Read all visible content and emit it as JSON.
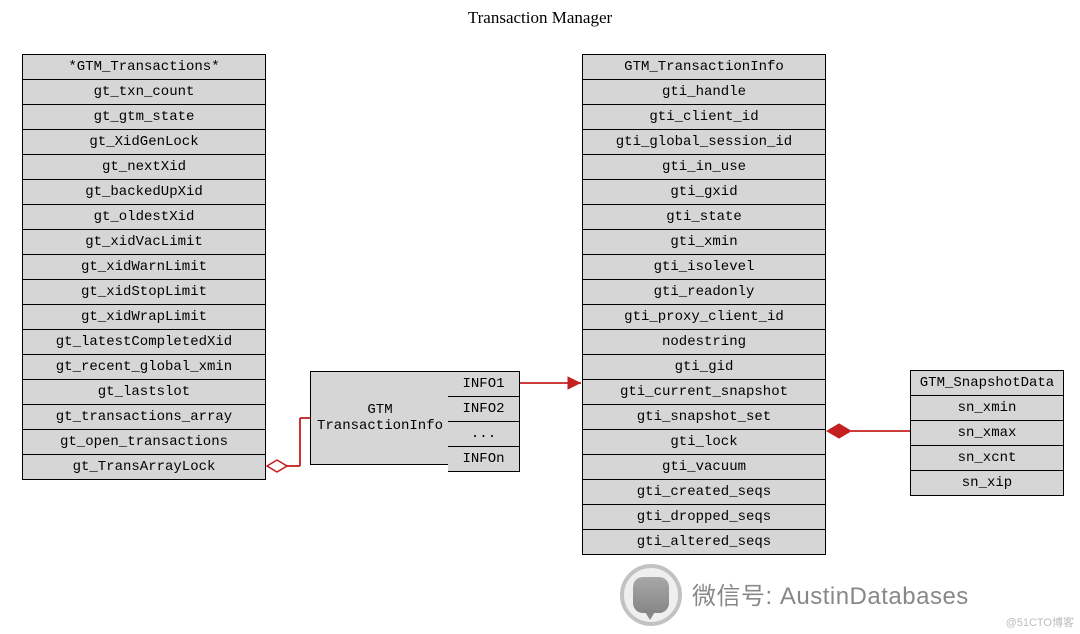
{
  "title": "Transaction Manager",
  "tables": {
    "gtm_transactions": {
      "header": "*GTM_Transactions*",
      "rows": [
        "gt_txn_count",
        "gt_gtm_state",
        "gt_XidGenLock",
        "gt_nextXid",
        "gt_backedUpXid",
        "gt_oldestXid",
        "gt_xidVacLimit",
        "gt_xidWarnLimit",
        "gt_xidStopLimit",
        "gt_xidWrapLimit",
        "gt_latestCompletedXid",
        "gt_recent_global_xmin",
        "gt_lastslot",
        "gt_transactions_array",
        "gt_open_transactions",
        "gt_TransArrayLock"
      ]
    },
    "mid": {
      "label_line1": "GTM",
      "label_line2": "TransactionInfo",
      "slots": [
        "INFO1",
        "INFO2",
        "...",
        "INFOn"
      ]
    },
    "txn_info": {
      "header": "GTM_TransactionInfo",
      "rows": [
        "gti_handle",
        "gti_client_id",
        "gti_global_session_id",
        "gti_in_use",
        "gti_gxid",
        "gti_state",
        "gti_xmin",
        "gti_isolevel",
        "gti_readonly",
        "gti_proxy_client_id",
        "nodestring",
        "gti_gid",
        "gti_current_snapshot",
        "gti_snapshot_set",
        "gti_lock",
        "gti_vacuum",
        "gti_created_seqs",
        "gti_dropped_seqs",
        "gti_altered_seqs"
      ]
    },
    "snapshot": {
      "header": "GTM_SnapshotData",
      "rows": [
        "sn_xmin",
        "sn_xmax",
        "sn_xcnt",
        "sn_xip"
      ]
    }
  },
  "watermark": {
    "prefix": "微信号:",
    "name": "AustinDatabases",
    "credit": "@51CTO博客"
  },
  "chart_data": {
    "type": "table",
    "description": "UML-style class/struct diagram for a distributed transaction manager (GTM).",
    "entities": [
      {
        "name": "GTM_Transactions",
        "fields": [
          "gt_txn_count",
          "gt_gtm_state",
          "gt_XidGenLock",
          "gt_nextXid",
          "gt_backedUpXid",
          "gt_oldestXid",
          "gt_xidVacLimit",
          "gt_xidWarnLimit",
          "gt_xidStopLimit",
          "gt_xidWrapLimit",
          "gt_latestCompletedXid",
          "gt_recent_global_xmin",
          "gt_lastslot",
          "gt_transactions_array",
          "gt_open_transactions",
          "gt_TransArrayLock"
        ]
      },
      {
        "name": "GTM TransactionInfo (array)",
        "fields": [
          "INFO1",
          "INFO2",
          "...",
          "INFOn"
        ]
      },
      {
        "name": "GTM_TransactionInfo",
        "fields": [
          "gti_handle",
          "gti_client_id",
          "gti_global_session_id",
          "gti_in_use",
          "gti_gxid",
          "gti_state",
          "gti_xmin",
          "gti_isolevel",
          "gti_readonly",
          "gti_proxy_client_id",
          "nodestring",
          "gti_gid",
          "gti_current_snapshot",
          "gti_snapshot_set",
          "gti_lock",
          "gti_vacuum",
          "gti_created_seqs",
          "gti_dropped_seqs",
          "gti_altered_seqs"
        ]
      },
      {
        "name": "GTM_SnapshotData",
        "fields": [
          "sn_xmin",
          "sn_xmax",
          "sn_xcnt",
          "sn_xip"
        ]
      }
    ],
    "relations": [
      {
        "from": "GTM_Transactions.gt_transactions_array",
        "to": "GTM TransactionInfo (array)",
        "kind": "aggregation"
      },
      {
        "from": "GTM TransactionInfo (array).INFO1",
        "to": "GTM_TransactionInfo",
        "kind": "association"
      },
      {
        "from": "GTM_TransactionInfo.gti_current_snapshot",
        "to": "GTM_SnapshotData",
        "kind": "composition"
      }
    ]
  }
}
